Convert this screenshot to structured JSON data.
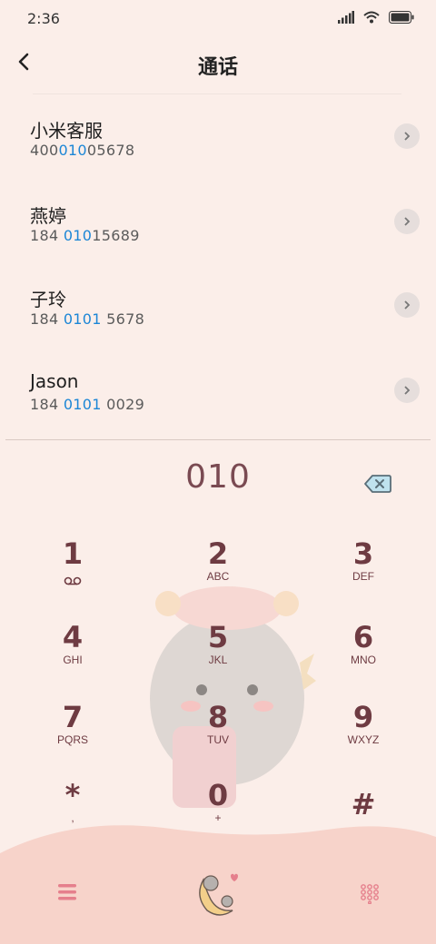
{
  "status_bar": {
    "time": "2:36"
  },
  "header": {
    "title": "通话"
  },
  "contacts": [
    {
      "name": "小米客服",
      "num_pre": "400",
      "num_match": "010",
      "num_post": "05678"
    },
    {
      "name": "燕婷",
      "num_pre": "184 ",
      "num_match": "010",
      "num_post": "15689"
    },
    {
      "name": "子玲",
      "num_pre": "184 ",
      "num_match": "0101",
      "num_post": " 5678"
    },
    {
      "name": "Jason",
      "num_pre": "184 ",
      "num_match": "0101",
      "num_post": " 0029"
    }
  ],
  "dialer": {
    "input": "010"
  },
  "keypad": [
    {
      "digit": "1",
      "letters": ""
    },
    {
      "digit": "2",
      "letters": "ABC"
    },
    {
      "digit": "3",
      "letters": "DEF"
    },
    {
      "digit": "4",
      "letters": "GHI"
    },
    {
      "digit": "5",
      "letters": "JKL"
    },
    {
      "digit": "6",
      "letters": "MNO"
    },
    {
      "digit": "7",
      "letters": "PQRS"
    },
    {
      "digit": "8",
      "letters": "TUV"
    },
    {
      "digit": "9",
      "letters": "WXYZ"
    },
    {
      "digit": "*",
      "letters": ","
    },
    {
      "digit": "0",
      "letters": "+"
    },
    {
      "digit": "#",
      "letters": ""
    }
  ],
  "colors": {
    "accent": "#1c86d6",
    "key_text": "#6e3b42",
    "wave": "#f7d3ca",
    "background": "#fbeee9"
  },
  "icons": [
    "back-arrow-icon",
    "chevron-right-icon",
    "backspace-icon",
    "voicemail-icon",
    "menu-icon",
    "call-mascot-icon",
    "keypad-icon"
  ]
}
